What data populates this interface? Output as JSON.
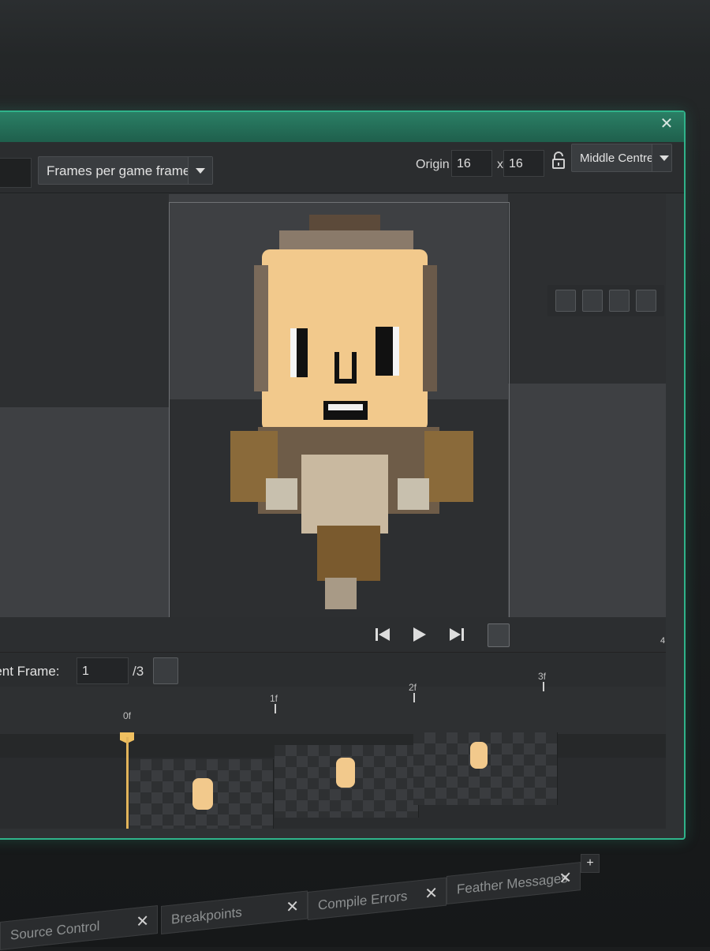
{
  "window": {
    "close_icon": "close-icon"
  },
  "toolbar": {
    "playback_mode": "Frames per game frame",
    "origin_label": "Origin",
    "origin_x": "16",
    "origin_y": "16",
    "x_separator": "x",
    "origin_preset": "Middle Centre"
  },
  "playback": {
    "current_frame_label": "rrent Frame:",
    "current_frame_value": "1",
    "total_frames": "/3",
    "end_marker": "4"
  },
  "timeline": {
    "ticks": [
      "0f",
      "1f",
      "2f",
      "3f"
    ]
  },
  "bottom_tabs": [
    {
      "label": "Source Control"
    },
    {
      "label": "Breakpoints"
    },
    {
      "label": "Compile Errors"
    },
    {
      "label": "Feather Messages"
    }
  ],
  "add_tab_label": "+",
  "colors": {
    "accent": "#2fb38a",
    "playhead": "#e2b45a",
    "skin": "#f2c98c"
  }
}
